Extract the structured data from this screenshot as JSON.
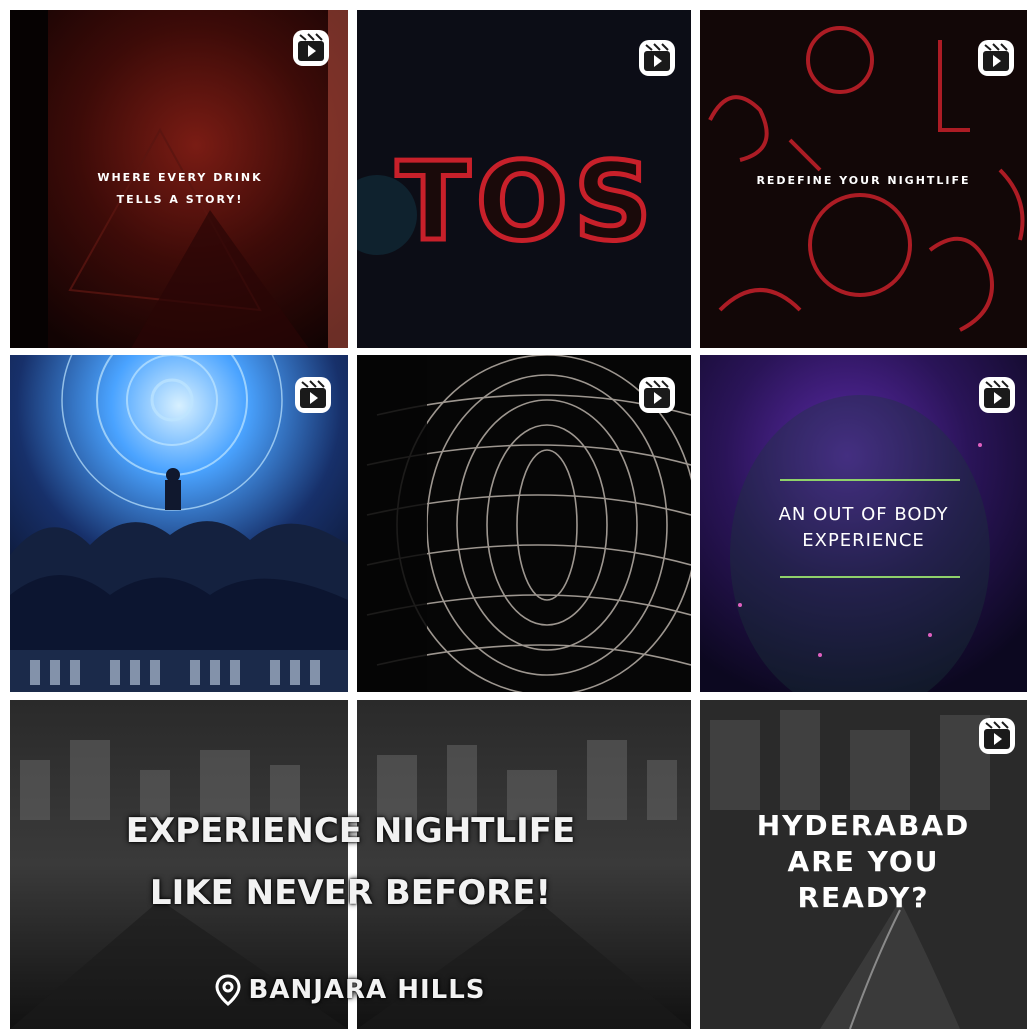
{
  "grid": {
    "icon": "reels-icon",
    "tiles": [
      {
        "caption": "WHERE EVERY DRINK\nTELLS A STORY!"
      },
      {
        "caption": "TOS"
      },
      {
        "caption": "REDEFINE YOUR NIGHTLIFE"
      },
      {
        "caption": ""
      },
      {
        "caption": ""
      },
      {
        "caption": "AN OUT OF BODY\nEXPERIENCE"
      },
      {
        "caption": "HYDERABAD\nARE YOU\nREADY?"
      }
    ],
    "wide_tile": {
      "headline_line1": "EXPERIENCE NIGHTLIFE",
      "headline_line2": "LIKE NEVER BEFORE!",
      "location_icon": "location-pin-icon",
      "location": "BANJARA HILLS"
    }
  },
  "colors": {
    "background": "#ffffff",
    "neon_red": "#c8202a",
    "neon_blue": "#4aa3ff",
    "neon_purple": "#5b2aa8",
    "neon_green": "#8fd16a"
  }
}
